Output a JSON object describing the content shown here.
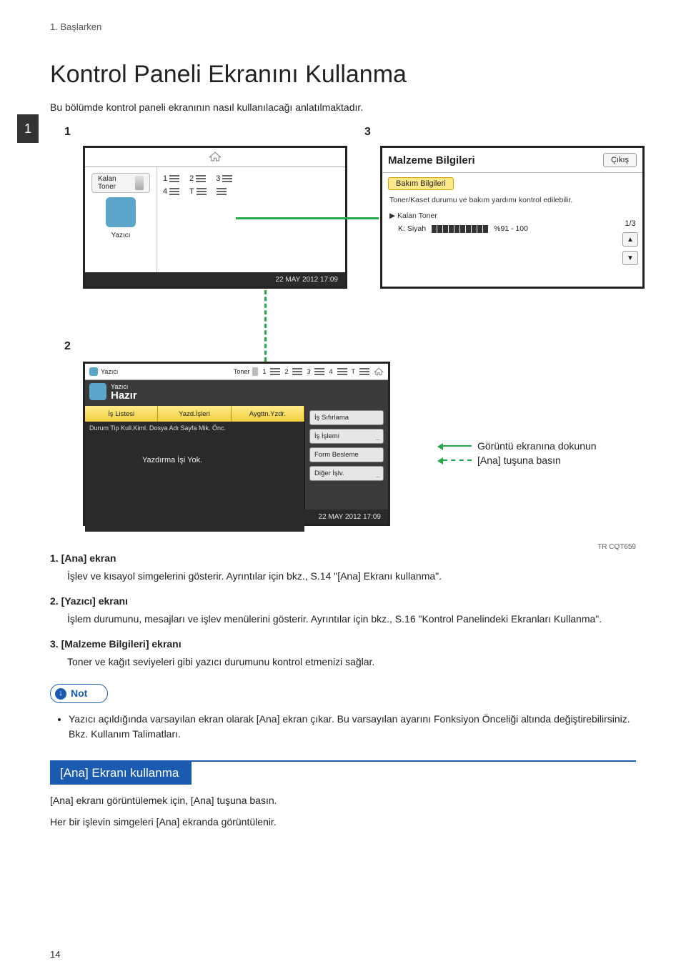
{
  "header": {
    "breadcrumb": "1. Başlarken"
  },
  "title": "Kontrol Paneli Ekranını Kullanma",
  "chapter_badge": "1",
  "intro": "Bu bölümde kontrol paneli ekranının nasıl kullanılacağı anlatılmaktadır.",
  "callouts": {
    "c1": "1",
    "c2": "2",
    "c3": "3"
  },
  "screen1": {
    "left_btn": "Kalan Toner",
    "printer_label": "Yazıcı",
    "grid": {
      "n1": "1",
      "n2": "2",
      "n3": "3",
      "n4": "4",
      "nT": "T"
    },
    "status_time": "22 MAY 2012 17:09"
  },
  "screen3": {
    "title": "Malzeme Bilgileri",
    "exit_btn": "Çıkış",
    "tab": "Bakım Bilgileri",
    "line1": "Toner/Kaset durumu ve bakım yardımı kontrol edilebilir.",
    "item_header": "▶ Kalan Toner",
    "row_label": "K: Siyah",
    "row_pct": "%91 - 100",
    "frac": "1/3",
    "up": "▲",
    "down": "▼"
  },
  "screen2": {
    "top_yazici": "Yazıcı",
    "top_toner": "Toner",
    "top_nums": {
      "n1": "1",
      "n2": "2",
      "n3": "3",
      "n4": "4",
      "nT": "T"
    },
    "title_small": "Yazıcı",
    "title_big": "Hazır",
    "tabs": {
      "t1": "İş Listesi",
      "t2": "Yazd.İşleri",
      "t3": "Aygttn.Yzdr."
    },
    "cols": "Durum  Tip  Kull.Kiml.   Dosya Adı   Sayfa Mik. Önc.",
    "msg": "Yazdırma İşi Yok.",
    "rbtns": {
      "b1": "İş Sıfırlama",
      "b2": "İş İşlemi",
      "b3": "Form Besleme",
      "b4": "Diğer İşlv."
    },
    "status_time": "22 MAY 2012 17:09"
  },
  "legend": {
    "touch": "Görüntü ekranına dokunun",
    "press": "[Ana] tuşuna basın"
  },
  "figure_code": "TR CQT659",
  "list": {
    "i1_h": "1. [Ana] ekran",
    "i1_b": "İşlev ve kısayol simgelerini gösterir. Ayrıntılar için bkz., S.14 \"[Ana] Ekranı kullanma\".",
    "i2_h": "2. [Yazıcı] ekranı",
    "i2_b": "İşlem durumunu, mesajları ve işlev menülerini gösterir. Ayrıntılar için bkz., S.16 \"Kontrol Panelindeki Ekranları Kullanma\".",
    "i3_h": "3. [Malzeme Bilgileri] ekranı",
    "i3_b": "Toner ve kağıt seviyeleri gibi yazıcı durumunu kontrol etmenizi sağlar."
  },
  "note_label": "Not",
  "note_items": {
    "n1": "Yazıcı açıldığında varsayılan ekran olarak [Ana] ekran çıkar. Bu varsayılan ayarını Fonksiyon Önceliği altında değiştirebilirsiniz. Bkz. Kullanım Talimatları."
  },
  "section_title": "[Ana] Ekranı kullanma",
  "after": {
    "p1": "[Ana] ekranı görüntülemek için, [Ana] tuşuna basın.",
    "p2": "Her bir işlevin simgeleri [Ana] ekranda görüntülenir."
  },
  "page_number": "14"
}
